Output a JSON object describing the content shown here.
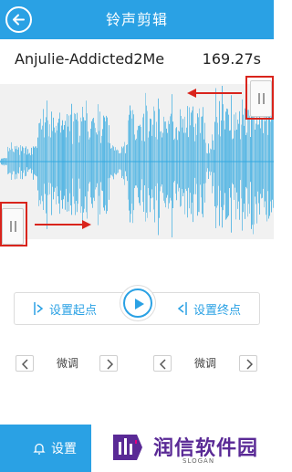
{
  "titlebar": {
    "title": "铃声剪辑",
    "back_icon": "back-arrow-icon"
  },
  "song": {
    "name": "Anjulie-Addicted2Me",
    "duration": "169.27s"
  },
  "waveform": {
    "color": "#33a9e0"
  },
  "controls": {
    "set_start_label": "设置起点",
    "set_end_label": "设置终点"
  },
  "tune_left": {
    "label": "微调"
  },
  "tune_right": {
    "label": "微调"
  },
  "bottom": {
    "settings_label": "设置",
    "logo_text": "润信软件园",
    "slogan": "SLOGAN"
  },
  "colors": {
    "accent": "#2aa1e4",
    "highlight": "#d9241c"
  }
}
